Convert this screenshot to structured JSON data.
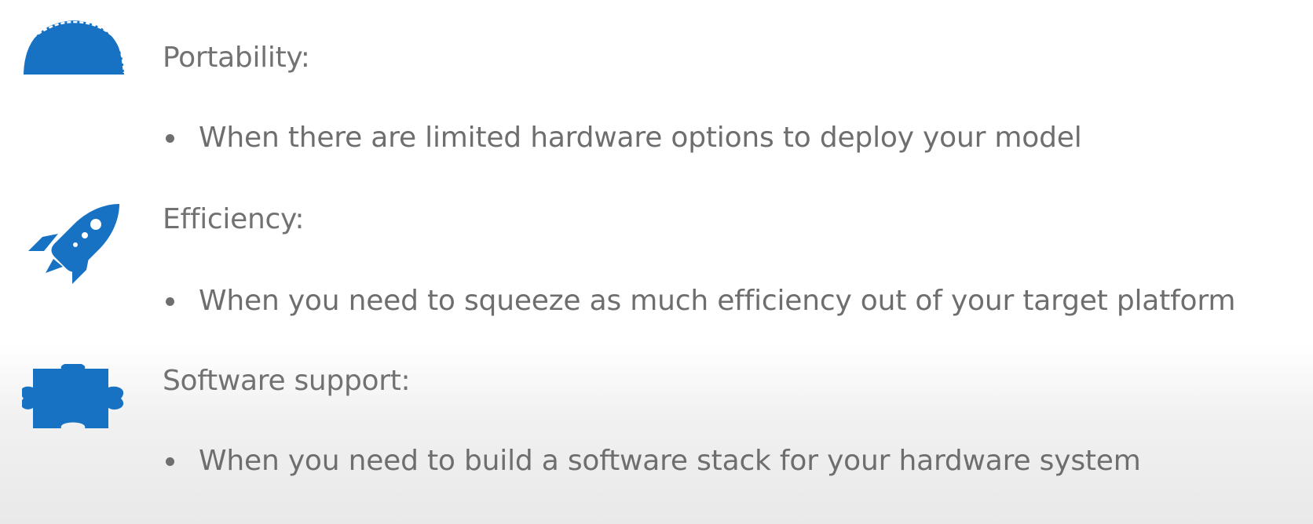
{
  "colors": {
    "icon_blue": "#1872c4",
    "text_gray": "#707070"
  },
  "sections": [
    {
      "icon": "taco-icon",
      "heading": "Portability:",
      "bullet": "When there are limited hardware options to deploy your model"
    },
    {
      "icon": "rocket-icon",
      "heading": "Efficiency:",
      "bullet": "When you need to squeeze as much efficiency out of your target platform"
    },
    {
      "icon": "puzzle-icon",
      "heading": "Software support:",
      "bullet": "When you need to build a software stack for your hardware system"
    }
  ]
}
